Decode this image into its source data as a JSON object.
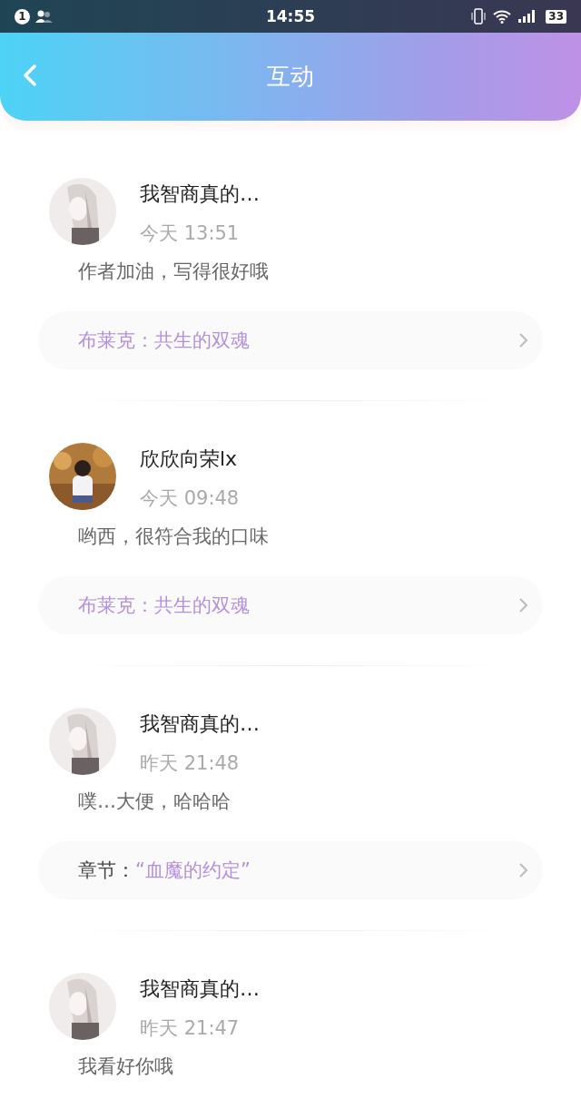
{
  "status_bar": {
    "notification_count": "1",
    "time": "14:55",
    "battery": "33"
  },
  "header": {
    "title": "互动"
  },
  "comments": [
    {
      "user": "我智商真的…",
      "time": "今天 13:51",
      "text": "作者加油，写得很好哦",
      "link": {
        "title": "布莱克：共生的双魂"
      }
    },
    {
      "user": "欣欣向荣lx",
      "time": "今天 09:48",
      "text": "哟西，很符合我的口味",
      "link": {
        "title": "布莱克：共生的双魂"
      }
    },
    {
      "user": "我智商真的…",
      "time": "昨天 21:48",
      "text": "噗…大便，哈哈哈",
      "link": {
        "prefix": "章节：",
        "title": "“血魔的约定”"
      }
    },
    {
      "user": "我智商真的…",
      "time": "昨天 21:47",
      "text": "我看好你哦"
    }
  ]
}
